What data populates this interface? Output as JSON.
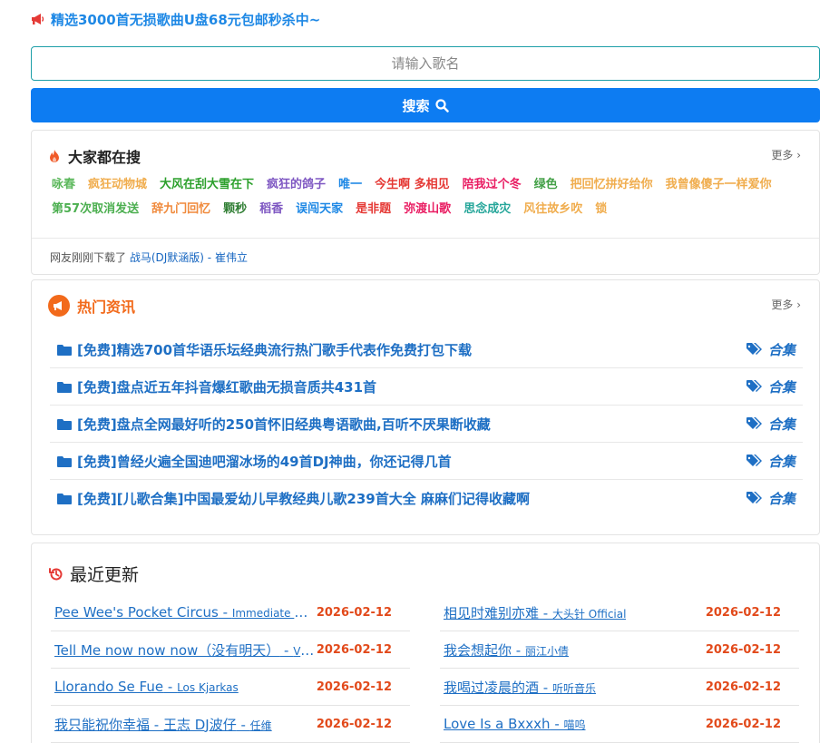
{
  "promo": {
    "text": "精选3000首无损歌曲U盘68元包邮秒杀中~"
  },
  "search": {
    "placeholder": "请输入歌名",
    "button_label": "搜索"
  },
  "hot_search": {
    "title": "大家都在搜",
    "more": "更多",
    "tags": [
      {
        "label": "咏春",
        "color": "#5cb85c"
      },
      {
        "label": "疯狂动物城",
        "color": "#f0ad4e"
      },
      {
        "label": "大风在刮大雪在下",
        "color": "#2ca02c"
      },
      {
        "label": "疯狂的鸽子",
        "color": "#7e57c2"
      },
      {
        "label": "唯一",
        "color": "#1e88e5"
      },
      {
        "label": "今生啊 多相见",
        "color": "#e53935"
      },
      {
        "label": "陪我过个冬",
        "color": "#e91e63"
      },
      {
        "label": "绿色",
        "color": "#43a047"
      },
      {
        "label": "把回忆拼好给你",
        "color": "#f0ad4e"
      },
      {
        "label": "我曾像傻子一样爱你",
        "color": "#f0ad4e"
      },
      {
        "label": "第57次取消发送",
        "color": "#4caf50"
      },
      {
        "label": "辞九门回忆",
        "color": "#f08a3c"
      },
      {
        "label": "颗秒",
        "color": "#2e7d32"
      },
      {
        "label": "稻香",
        "color": "#7e57c2"
      },
      {
        "label": "误闯天家",
        "color": "#1e88e5"
      },
      {
        "label": "是非题",
        "color": "#e53935"
      },
      {
        "label": "弥渡山歌",
        "color": "#e91e63"
      },
      {
        "label": "思念成灾",
        "color": "#26a69a"
      },
      {
        "label": "风往故乡吹",
        "color": "#f0ad4e"
      },
      {
        "label": "锁",
        "color": "#f0ad4e"
      }
    ],
    "recent_download": {
      "prefix": "网友刚刚下载了",
      "song": "战马(DJ默涵版) - 崔伟立"
    }
  },
  "news": {
    "title": "热门资讯",
    "more": "更多",
    "items": [
      {
        "title": "[免费]精选700首华语乐坛经典流行热门歌手代表作免费打包下载",
        "category": "合集"
      },
      {
        "title": "[免费]盘点近五年抖音爆红歌曲无损音质共431首",
        "category": "合集"
      },
      {
        "title": "[免费]盘点全网最好听的250首怀旧经典粤语歌曲,百听不厌果断收藏",
        "category": "合集"
      },
      {
        "title": "[免费]曾经火遍全国迪吧溜冰场的49首DJ神曲，你还记得几首",
        "category": "合集"
      },
      {
        "title": "[免费][儿歌合集]中国最爱幼儿早教经典儿歌239首大全 麻麻们记得收藏啊",
        "category": "合集"
      }
    ]
  },
  "recent": {
    "title": "最近更新",
    "left": [
      {
        "song": "Pee Wee's Pocket Circus",
        "artist": "Immediate Music",
        "date": "2026-02-12"
      },
      {
        "song": "Tell Me now now now（没有明天）",
        "artist": "Vibe",
        "date": "2026-02-12"
      },
      {
        "song": "Llorando Se Fue",
        "artist": "Los Kjarkas",
        "date": "2026-02-12"
      },
      {
        "song": "我只能祝你幸福 - 王志 DJ波仔",
        "artist": "任维",
        "date": "2026-02-12"
      }
    ],
    "right": [
      {
        "song": "相见时难别亦难",
        "artist": "大头针 Official",
        "date": "2026-02-12"
      },
      {
        "song": "我会想起你",
        "artist": "丽江小倩",
        "date": "2026-02-12"
      },
      {
        "song": "我喝过凌晨的酒",
        "artist": "听听音乐",
        "date": "2026-02-12"
      },
      {
        "song": "Love Is a Bxxxh",
        "artist": "喵呜",
        "date": "2026-02-12"
      }
    ]
  }
}
